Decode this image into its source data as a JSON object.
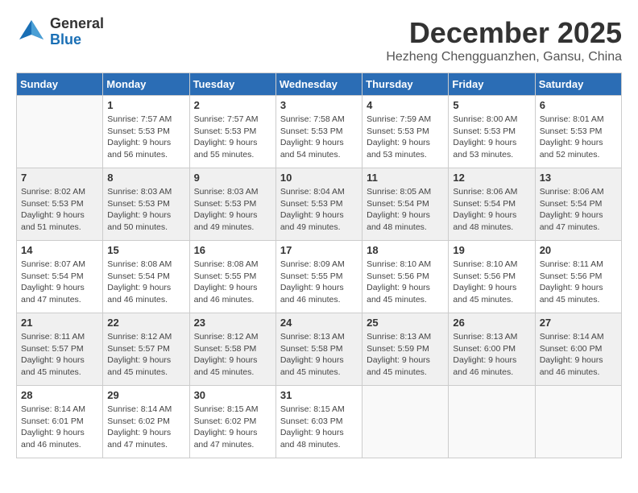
{
  "logo": {
    "general": "General",
    "blue": "Blue"
  },
  "header": {
    "month": "December 2025",
    "location": "Hezheng Chengguanzhen, Gansu, China"
  },
  "weekdays": [
    "Sunday",
    "Monday",
    "Tuesday",
    "Wednesday",
    "Thursday",
    "Friday",
    "Saturday"
  ],
  "weeks": [
    [
      {
        "day": "",
        "info": ""
      },
      {
        "day": "1",
        "info": "Sunrise: 7:57 AM\nSunset: 5:53 PM\nDaylight: 9 hours\nand 56 minutes."
      },
      {
        "day": "2",
        "info": "Sunrise: 7:57 AM\nSunset: 5:53 PM\nDaylight: 9 hours\nand 55 minutes."
      },
      {
        "day": "3",
        "info": "Sunrise: 7:58 AM\nSunset: 5:53 PM\nDaylight: 9 hours\nand 54 minutes."
      },
      {
        "day": "4",
        "info": "Sunrise: 7:59 AM\nSunset: 5:53 PM\nDaylight: 9 hours\nand 53 minutes."
      },
      {
        "day": "5",
        "info": "Sunrise: 8:00 AM\nSunset: 5:53 PM\nDaylight: 9 hours\nand 53 minutes."
      },
      {
        "day": "6",
        "info": "Sunrise: 8:01 AM\nSunset: 5:53 PM\nDaylight: 9 hours\nand 52 minutes."
      }
    ],
    [
      {
        "day": "7",
        "info": "Sunrise: 8:02 AM\nSunset: 5:53 PM\nDaylight: 9 hours\nand 51 minutes."
      },
      {
        "day": "8",
        "info": "Sunrise: 8:03 AM\nSunset: 5:53 PM\nDaylight: 9 hours\nand 50 minutes."
      },
      {
        "day": "9",
        "info": "Sunrise: 8:03 AM\nSunset: 5:53 PM\nDaylight: 9 hours\nand 49 minutes."
      },
      {
        "day": "10",
        "info": "Sunrise: 8:04 AM\nSunset: 5:53 PM\nDaylight: 9 hours\nand 49 minutes."
      },
      {
        "day": "11",
        "info": "Sunrise: 8:05 AM\nSunset: 5:54 PM\nDaylight: 9 hours\nand 48 minutes."
      },
      {
        "day": "12",
        "info": "Sunrise: 8:06 AM\nSunset: 5:54 PM\nDaylight: 9 hours\nand 48 minutes."
      },
      {
        "day": "13",
        "info": "Sunrise: 8:06 AM\nSunset: 5:54 PM\nDaylight: 9 hours\nand 47 minutes."
      }
    ],
    [
      {
        "day": "14",
        "info": "Sunrise: 8:07 AM\nSunset: 5:54 PM\nDaylight: 9 hours\nand 47 minutes."
      },
      {
        "day": "15",
        "info": "Sunrise: 8:08 AM\nSunset: 5:54 PM\nDaylight: 9 hours\nand 46 minutes."
      },
      {
        "day": "16",
        "info": "Sunrise: 8:08 AM\nSunset: 5:55 PM\nDaylight: 9 hours\nand 46 minutes."
      },
      {
        "day": "17",
        "info": "Sunrise: 8:09 AM\nSunset: 5:55 PM\nDaylight: 9 hours\nand 46 minutes."
      },
      {
        "day": "18",
        "info": "Sunrise: 8:10 AM\nSunset: 5:56 PM\nDaylight: 9 hours\nand 45 minutes."
      },
      {
        "day": "19",
        "info": "Sunrise: 8:10 AM\nSunset: 5:56 PM\nDaylight: 9 hours\nand 45 minutes."
      },
      {
        "day": "20",
        "info": "Sunrise: 8:11 AM\nSunset: 5:56 PM\nDaylight: 9 hours\nand 45 minutes."
      }
    ],
    [
      {
        "day": "21",
        "info": "Sunrise: 8:11 AM\nSunset: 5:57 PM\nDaylight: 9 hours\nand 45 minutes."
      },
      {
        "day": "22",
        "info": "Sunrise: 8:12 AM\nSunset: 5:57 PM\nDaylight: 9 hours\nand 45 minutes."
      },
      {
        "day": "23",
        "info": "Sunrise: 8:12 AM\nSunset: 5:58 PM\nDaylight: 9 hours\nand 45 minutes."
      },
      {
        "day": "24",
        "info": "Sunrise: 8:13 AM\nSunset: 5:58 PM\nDaylight: 9 hours\nand 45 minutes."
      },
      {
        "day": "25",
        "info": "Sunrise: 8:13 AM\nSunset: 5:59 PM\nDaylight: 9 hours\nand 45 minutes."
      },
      {
        "day": "26",
        "info": "Sunrise: 8:13 AM\nSunset: 6:00 PM\nDaylight: 9 hours\nand 46 minutes."
      },
      {
        "day": "27",
        "info": "Sunrise: 8:14 AM\nSunset: 6:00 PM\nDaylight: 9 hours\nand 46 minutes."
      }
    ],
    [
      {
        "day": "28",
        "info": "Sunrise: 8:14 AM\nSunset: 6:01 PM\nDaylight: 9 hours\nand 46 minutes."
      },
      {
        "day": "29",
        "info": "Sunrise: 8:14 AM\nSunset: 6:02 PM\nDaylight: 9 hours\nand 47 minutes."
      },
      {
        "day": "30",
        "info": "Sunrise: 8:15 AM\nSunset: 6:02 PM\nDaylight: 9 hours\nand 47 minutes."
      },
      {
        "day": "31",
        "info": "Sunrise: 8:15 AM\nSunset: 6:03 PM\nDaylight: 9 hours\nand 48 minutes."
      },
      {
        "day": "",
        "info": ""
      },
      {
        "day": "",
        "info": ""
      },
      {
        "day": "",
        "info": ""
      }
    ]
  ]
}
